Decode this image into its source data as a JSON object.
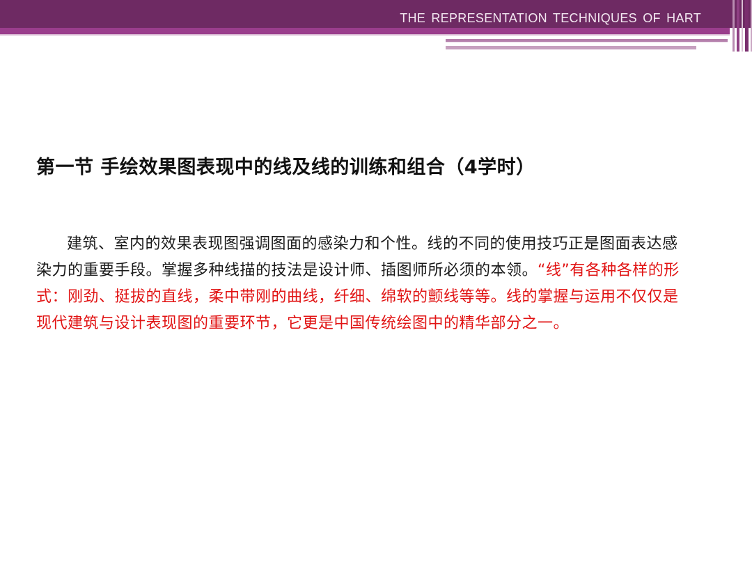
{
  "header": {
    "title": "THE  REPRESENTATION  TECHNIQUES  OF  HART"
  },
  "section": {
    "heading": "第一节  手绘效果图表现中的线及线的训练和组合（4学时）"
  },
  "body": {
    "normal_text": "建筑、室内的效果表现图强调图面的感染力和个性。线的不同的使用技巧正是图面表达感染力的重要手段。掌握多种线描的技法是设计师、插图师所必须的本领。",
    "highlight_text": "“线”有各种各样的形式：刚劲、挺拔的直线，柔中带刚的曲线，纤细、绵软的颤线等等。线的掌握与运用不仅仅是现代建筑与设计表现图的重要环节，它更是中国传统绘图中的精华部分之一。"
  },
  "colors": {
    "header_band": "#6e2a63",
    "header_accent": "#9a3d8c",
    "highlight_red": "#e11414"
  }
}
